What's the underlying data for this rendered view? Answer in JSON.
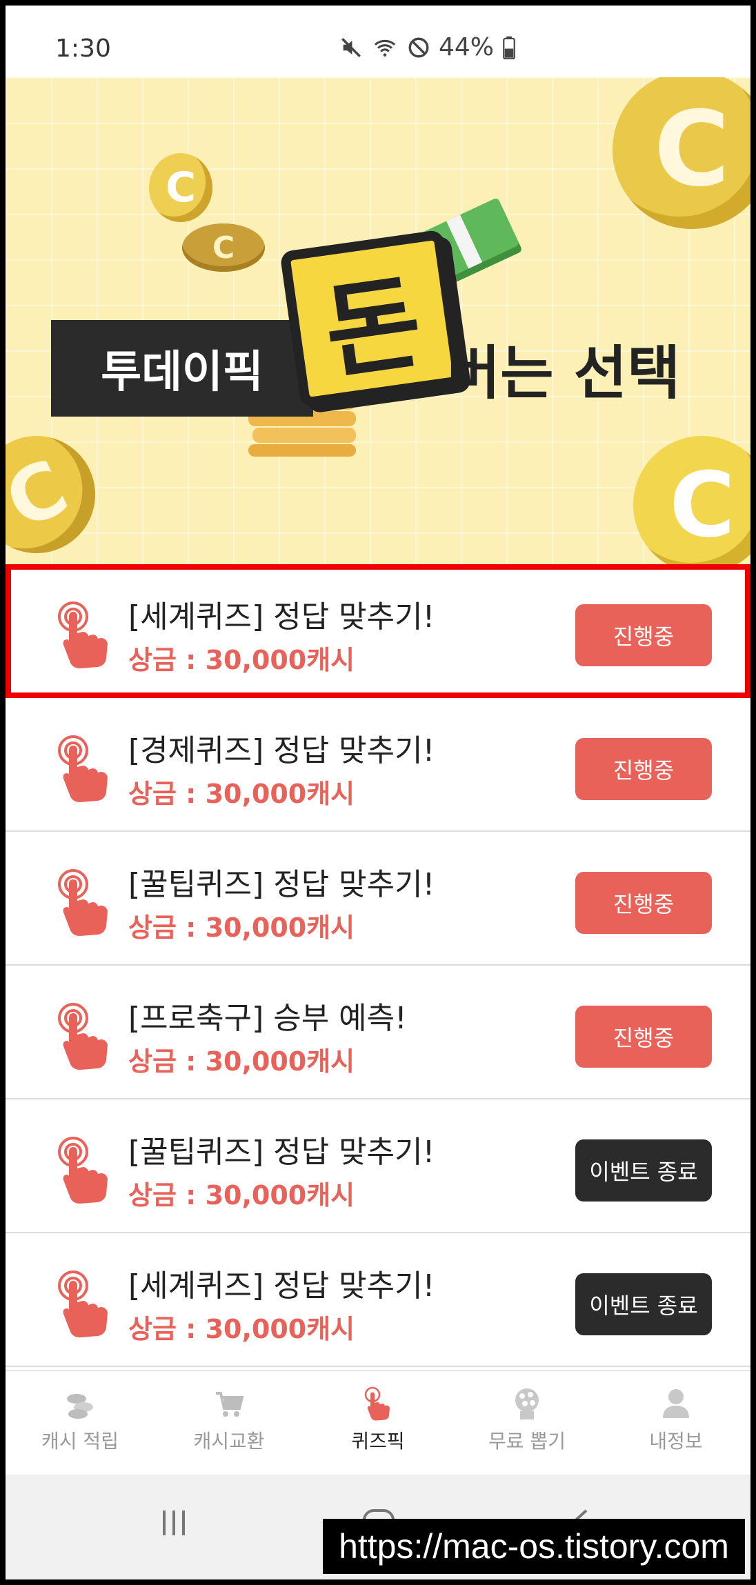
{
  "status_bar": {
    "time": "1:30",
    "battery": "44%"
  },
  "banner": {
    "title_left": "투데이픽",
    "title_highlight": "돈",
    "title_right": "버는 선택"
  },
  "quiz_list": [
    {
      "title": "[세계퀴즈] 정답 맞추기!",
      "prize": "상금 : 30,000캐시",
      "button": "진행중",
      "status": "active"
    },
    {
      "title": "[경제퀴즈] 정답 맞추기!",
      "prize": "상금 : 30,000캐시",
      "button": "진행중",
      "status": "active"
    },
    {
      "title": "[꿀팁퀴즈] 정답 맞추기!",
      "prize": "상금 : 30,000캐시",
      "button": "진행중",
      "status": "active"
    },
    {
      "title": "[프로축구] 승부 예측!",
      "prize": "상금 : 30,000캐시",
      "button": "진행중",
      "status": "active"
    },
    {
      "title": "[꿀팁퀴즈] 정답 맞추기!",
      "prize": "상금 : 30,000캐시",
      "button": "이벤트 종료",
      "status": "ended"
    },
    {
      "title": "[세계퀴즈] 정답 맞추기!",
      "prize": "상금 : 30,000캐시",
      "button": "이벤트 종료",
      "status": "ended"
    }
  ],
  "bottom_nav": [
    {
      "label": "캐시 적립",
      "icon": "coins-icon"
    },
    {
      "label": "캐시교환",
      "icon": "cart-icon"
    },
    {
      "label": "퀴즈픽",
      "icon": "tap-hand-icon",
      "active": true
    },
    {
      "label": "무료 뽑기",
      "icon": "gacha-icon"
    },
    {
      "label": "내정보",
      "icon": "user-icon"
    }
  ],
  "watermark": "https://mac-os.tistory.com",
  "colors": {
    "accent": "#e8625a",
    "ended": "#2b2b2b",
    "banner_bg": "#fdf0b6",
    "highlight_outline": "#ee0000"
  }
}
